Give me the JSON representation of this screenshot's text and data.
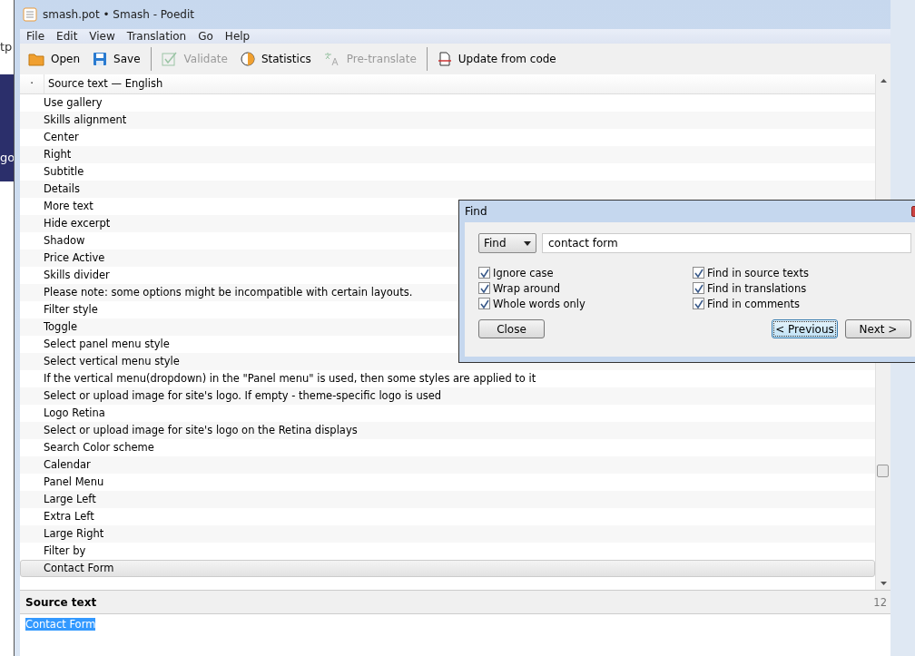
{
  "background_window": {
    "fragments": [
      "tp",
      "go"
    ]
  },
  "window": {
    "title": "smash.pot • Smash - Poedit"
  },
  "menu": [
    "File",
    "Edit",
    "View",
    "Translation",
    "Go",
    "Help"
  ],
  "toolbar": [
    {
      "kind": "open",
      "label": "Open",
      "disabled": false
    },
    {
      "kind": "save",
      "label": "Save",
      "disabled": false
    },
    {
      "kind": "separator"
    },
    {
      "kind": "validate",
      "label": "Validate",
      "disabled": true
    },
    {
      "kind": "statistics",
      "label": "Statistics",
      "disabled": false
    },
    {
      "kind": "pretranslate",
      "label": "Pre-translate",
      "disabled": true
    },
    {
      "kind": "separator"
    },
    {
      "kind": "update",
      "label": "Update from code",
      "disabled": false
    }
  ],
  "list": {
    "header_marker": "·",
    "header": "Source text — English",
    "rows": [
      {
        "text": "Use gallery",
        "selected": false
      },
      {
        "text": "Skills alignment",
        "selected": false
      },
      {
        "text": "Center",
        "selected": false
      },
      {
        "text": "Right",
        "selected": false
      },
      {
        "text": "Subtitle",
        "selected": false
      },
      {
        "text": "Details",
        "selected": false
      },
      {
        "text": "More text",
        "selected": false
      },
      {
        "text": "Hide excerpt",
        "selected": false
      },
      {
        "text": "Shadow",
        "selected": false
      },
      {
        "text": "Price Active",
        "selected": false
      },
      {
        "text": "Skills divider",
        "selected": false
      },
      {
        "text": "Please note: some options might be incompatible with certain layouts.",
        "selected": false
      },
      {
        "text": "Filter style",
        "selected": false
      },
      {
        "text": "Toggle",
        "selected": false
      },
      {
        "text": "Select panel menu style",
        "selected": false
      },
      {
        "text": "Select vertical menu style",
        "selected": false
      },
      {
        "text": "If the vertical menu(dropdown) in the \"Panel menu\" is used, then some styles are applied to it",
        "selected": false
      },
      {
        "text": "Select or upload image for site's logo. If empty - theme-specific logo is used",
        "selected": false
      },
      {
        "text": "Logo Retina",
        "selected": false
      },
      {
        "text": "Select or upload image for site's logo on the Retina displays",
        "selected": false
      },
      {
        "text": "Search Color scheme",
        "selected": false
      },
      {
        "text": "Calendar",
        "selected": false
      },
      {
        "text": "Panel Menu",
        "selected": false
      },
      {
        "text": "Large Left",
        "selected": false
      },
      {
        "text": "Extra Left",
        "selected": false
      },
      {
        "text": "Large Right",
        "selected": false
      },
      {
        "text": "Filter by",
        "selected": false
      },
      {
        "text": "Contact Form",
        "selected": true
      }
    ]
  },
  "source_panel": {
    "title": "Source text",
    "count": "12",
    "text": "Contact Form"
  },
  "find_dialog": {
    "title": "Find",
    "mode": "Find",
    "query": "contact form",
    "options_left": [
      {
        "label": "Ignore case",
        "checked": true
      },
      {
        "label": "Wrap around",
        "checked": true
      },
      {
        "label": "Whole words only",
        "checked": true
      }
    ],
    "options_right": [
      {
        "label": "Find in source texts",
        "checked": true
      },
      {
        "label": "Find in translations",
        "checked": true
      },
      {
        "label": "Find in comments",
        "checked": true
      }
    ],
    "close": "Close",
    "previous": "< Previous",
    "next": "Next >"
  }
}
